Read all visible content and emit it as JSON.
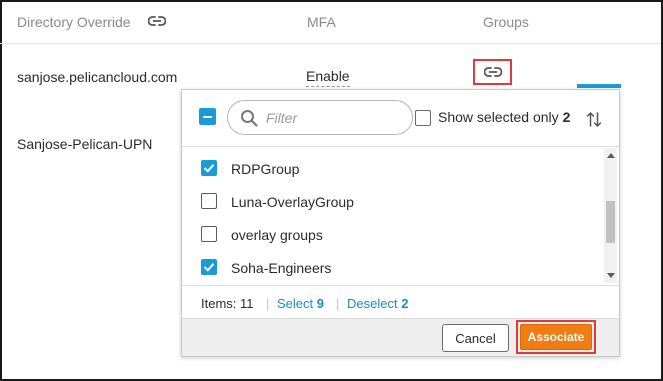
{
  "table": {
    "headers": {
      "directory_override": "Directory Override",
      "mfa": "MFA",
      "groups": "Groups"
    },
    "rows": [
      {
        "domain": "sanjose.pelicancloud.com",
        "mfa": "Enable"
      },
      {
        "domain": "Sanjose-Pelican-UPN"
      }
    ]
  },
  "popup": {
    "filter_placeholder": "Filter",
    "show_selected_label": "Show selected only",
    "show_selected_count": "2",
    "items": [
      {
        "label": "RDPGroup",
        "checked": true
      },
      {
        "label": "Luna-OverlayGroup",
        "checked": false
      },
      {
        "label": "overlay groups",
        "checked": false
      },
      {
        "label": "Soha-Engineers",
        "checked": true
      }
    ],
    "footer": {
      "items_label": "Items:",
      "items_count": "11",
      "select_label": "Select",
      "select_count": "9",
      "deselect_label": "Deselect",
      "deselect_count": "2"
    },
    "cancel_label": "Cancel",
    "associate_label": "Associate"
  },
  "colors": {
    "accent_blue": "#1a9bd7",
    "associate_orange": "#f07c12",
    "highlight_red": "#e03a3a"
  },
  "icons": {
    "header_link": "link-icon",
    "groups_link": "link-icon",
    "filter": "search-icon",
    "sort": "sort-arrows-icon"
  }
}
